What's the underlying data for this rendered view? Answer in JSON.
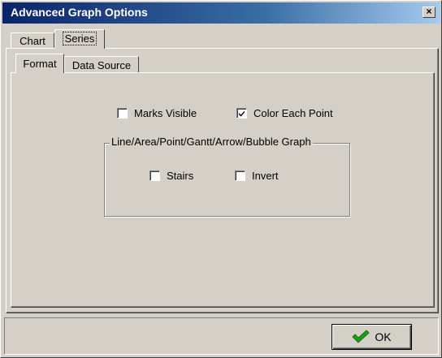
{
  "window": {
    "title": "Advanced Graph Options",
    "close_glyph": "×"
  },
  "outer_tabs": [
    {
      "label": "Chart",
      "active": false
    },
    {
      "label": "Series",
      "active": true
    }
  ],
  "inner_tabs": [
    {
      "label": "Format",
      "active": true
    },
    {
      "label": "Data Source",
      "active": false
    }
  ],
  "options": {
    "marks_visible": {
      "label": "Marks Visible",
      "checked": false
    },
    "color_each_point": {
      "label": "Color Each Point",
      "checked": true
    }
  },
  "group": {
    "label": "Line/Area/Point/Gantt/Arrow/Bubble Graph",
    "stairs": {
      "label": "Stairs",
      "checked": false
    },
    "invert": {
      "label": "Invert",
      "checked": false
    }
  },
  "footer": {
    "ok_label": "OK",
    "ok_icon": "checkmark-icon",
    "ok_icon_color": "#1a9e1a"
  },
  "colors": {
    "title_gradient_start": "#0a246a",
    "title_gradient_end": "#a6caf0",
    "face": "#d4d0c8"
  }
}
